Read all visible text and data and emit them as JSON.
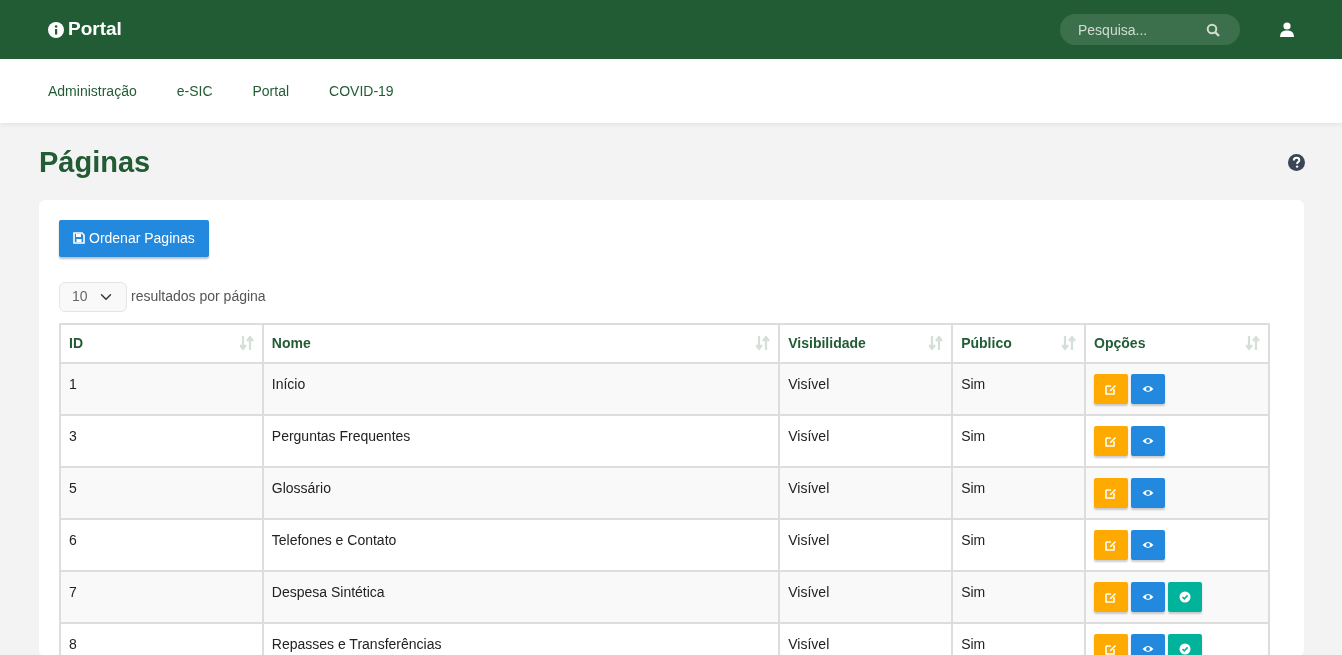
{
  "brand": {
    "title": "Portal"
  },
  "search": {
    "placeholder": "Pesquisa..."
  },
  "menu": [
    {
      "label": "Administração"
    },
    {
      "label": "e-SIC"
    },
    {
      "label": "Portal"
    },
    {
      "label": "COVID-19"
    }
  ],
  "page_title": "Páginas",
  "order_button": "Ordenar Paginas",
  "page_size": {
    "value": "10",
    "label": "resultados por página"
  },
  "table": {
    "columns": [
      "ID",
      "Nome",
      "Visibilidade",
      "Público",
      "Opções"
    ],
    "rows": [
      {
        "cells": [
          "1",
          "Início",
          "Visível",
          "Sim"
        ],
        "actions": [
          {
            "kind": "edit"
          },
          {
            "kind": "view"
          }
        ]
      },
      {
        "cells": [
          "3",
          "Perguntas Frequentes",
          "Visível",
          "Sim"
        ],
        "actions": [
          {
            "kind": "edit"
          },
          {
            "kind": "view"
          }
        ]
      },
      {
        "cells": [
          "5",
          "Glossário",
          "Visível",
          "Sim"
        ],
        "actions": [
          {
            "kind": "edit"
          },
          {
            "kind": "view"
          }
        ]
      },
      {
        "cells": [
          "6",
          "Telefones e Contato",
          "Visível",
          "Sim"
        ],
        "actions": [
          {
            "kind": "edit"
          },
          {
            "kind": "view"
          }
        ]
      },
      {
        "cells": [
          "7",
          "Despesa Sintética",
          "Visível",
          "Sim"
        ],
        "actions": [
          {
            "kind": "edit"
          },
          {
            "kind": "view"
          },
          {
            "kind": "approve"
          }
        ]
      },
      {
        "cells": [
          "8",
          "Repasses e Transferências",
          "Visível",
          "Sim"
        ],
        "actions": [
          {
            "kind": "edit"
          },
          {
            "kind": "view"
          },
          {
            "kind": "approve"
          }
        ]
      }
    ]
  }
}
